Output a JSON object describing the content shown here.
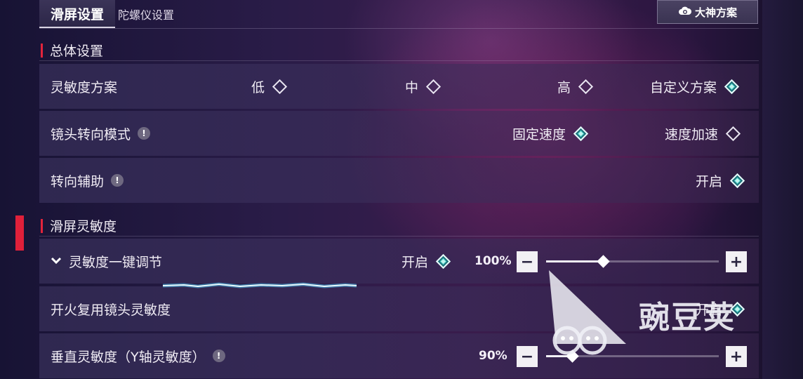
{
  "tabs": [
    {
      "label": "滑屏设置",
      "active": true
    },
    {
      "label": "陀螺仪设置",
      "active": false
    }
  ],
  "plan_button": {
    "label": "大神方案",
    "icon": "cloud-icon"
  },
  "sections": {
    "general": {
      "title": "总体设置"
    },
    "swipe": {
      "title": "滑屏灵敏度"
    }
  },
  "rows": {
    "sensitivity_plan": {
      "label": "灵敏度方案",
      "options": [
        {
          "label": "低",
          "selected": false
        },
        {
          "label": "中",
          "selected": false
        },
        {
          "label": "高",
          "selected": false
        },
        {
          "label": "自定义方案",
          "selected": true
        }
      ]
    },
    "camera_mode": {
      "label": "镜头转向模式",
      "options": [
        {
          "label": "固定速度",
          "selected": true
        },
        {
          "label": "速度加速",
          "selected": false
        }
      ]
    },
    "turn_assist": {
      "label": "转向辅助",
      "option": {
        "label": "开启",
        "selected": true
      }
    },
    "one_key": {
      "label": "灵敏度一键调节",
      "option": {
        "label": "开启",
        "selected": true
      },
      "value_text": "100%",
      "value": 1.0
    },
    "fire_reuse": {
      "label": "开火复用镜头灵敏度",
      "option": {
        "label": "开启",
        "selected": true
      }
    },
    "vertical": {
      "label": "垂直灵敏度（Y轴灵敏度）",
      "value_text": "90%",
      "value": 0.45
    }
  },
  "watermark": {
    "text": "豌豆荚"
  },
  "colors": {
    "accent_red": "#e2243c",
    "selected_teal": "#3fc9c0"
  }
}
